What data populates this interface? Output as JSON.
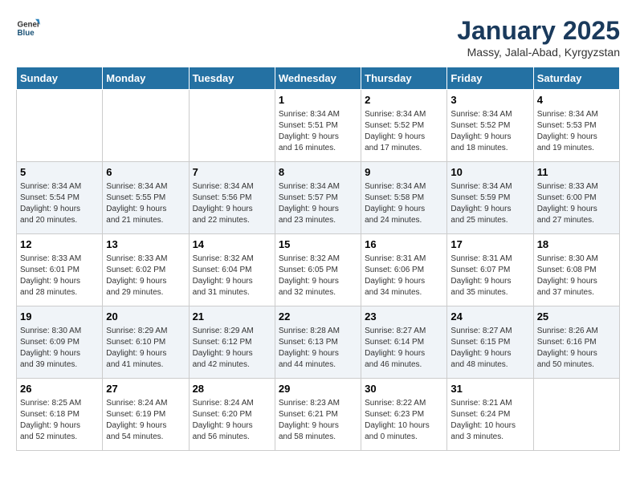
{
  "header": {
    "logo_general": "General",
    "logo_blue": "Blue",
    "month": "January 2025",
    "location": "Massy, Jalal-Abad, Kyrgyzstan"
  },
  "days_of_week": [
    "Sunday",
    "Monday",
    "Tuesday",
    "Wednesday",
    "Thursday",
    "Friday",
    "Saturday"
  ],
  "weeks": [
    {
      "days": [
        {
          "num": "",
          "info": ""
        },
        {
          "num": "",
          "info": ""
        },
        {
          "num": "",
          "info": ""
        },
        {
          "num": "1",
          "info": "Sunrise: 8:34 AM\nSunset: 5:51 PM\nDaylight: 9 hours\nand 16 minutes."
        },
        {
          "num": "2",
          "info": "Sunrise: 8:34 AM\nSunset: 5:52 PM\nDaylight: 9 hours\nand 17 minutes."
        },
        {
          "num": "3",
          "info": "Sunrise: 8:34 AM\nSunset: 5:52 PM\nDaylight: 9 hours\nand 18 minutes."
        },
        {
          "num": "4",
          "info": "Sunrise: 8:34 AM\nSunset: 5:53 PM\nDaylight: 9 hours\nand 19 minutes."
        }
      ]
    },
    {
      "days": [
        {
          "num": "5",
          "info": "Sunrise: 8:34 AM\nSunset: 5:54 PM\nDaylight: 9 hours\nand 20 minutes."
        },
        {
          "num": "6",
          "info": "Sunrise: 8:34 AM\nSunset: 5:55 PM\nDaylight: 9 hours\nand 21 minutes."
        },
        {
          "num": "7",
          "info": "Sunrise: 8:34 AM\nSunset: 5:56 PM\nDaylight: 9 hours\nand 22 minutes."
        },
        {
          "num": "8",
          "info": "Sunrise: 8:34 AM\nSunset: 5:57 PM\nDaylight: 9 hours\nand 23 minutes."
        },
        {
          "num": "9",
          "info": "Sunrise: 8:34 AM\nSunset: 5:58 PM\nDaylight: 9 hours\nand 24 minutes."
        },
        {
          "num": "10",
          "info": "Sunrise: 8:34 AM\nSunset: 5:59 PM\nDaylight: 9 hours\nand 25 minutes."
        },
        {
          "num": "11",
          "info": "Sunrise: 8:33 AM\nSunset: 6:00 PM\nDaylight: 9 hours\nand 27 minutes."
        }
      ]
    },
    {
      "days": [
        {
          "num": "12",
          "info": "Sunrise: 8:33 AM\nSunset: 6:01 PM\nDaylight: 9 hours\nand 28 minutes."
        },
        {
          "num": "13",
          "info": "Sunrise: 8:33 AM\nSunset: 6:02 PM\nDaylight: 9 hours\nand 29 minutes."
        },
        {
          "num": "14",
          "info": "Sunrise: 8:32 AM\nSunset: 6:04 PM\nDaylight: 9 hours\nand 31 minutes."
        },
        {
          "num": "15",
          "info": "Sunrise: 8:32 AM\nSunset: 6:05 PM\nDaylight: 9 hours\nand 32 minutes."
        },
        {
          "num": "16",
          "info": "Sunrise: 8:31 AM\nSunset: 6:06 PM\nDaylight: 9 hours\nand 34 minutes."
        },
        {
          "num": "17",
          "info": "Sunrise: 8:31 AM\nSunset: 6:07 PM\nDaylight: 9 hours\nand 35 minutes."
        },
        {
          "num": "18",
          "info": "Sunrise: 8:30 AM\nSunset: 6:08 PM\nDaylight: 9 hours\nand 37 minutes."
        }
      ]
    },
    {
      "days": [
        {
          "num": "19",
          "info": "Sunrise: 8:30 AM\nSunset: 6:09 PM\nDaylight: 9 hours\nand 39 minutes."
        },
        {
          "num": "20",
          "info": "Sunrise: 8:29 AM\nSunset: 6:10 PM\nDaylight: 9 hours\nand 41 minutes."
        },
        {
          "num": "21",
          "info": "Sunrise: 8:29 AM\nSunset: 6:12 PM\nDaylight: 9 hours\nand 42 minutes."
        },
        {
          "num": "22",
          "info": "Sunrise: 8:28 AM\nSunset: 6:13 PM\nDaylight: 9 hours\nand 44 minutes."
        },
        {
          "num": "23",
          "info": "Sunrise: 8:27 AM\nSunset: 6:14 PM\nDaylight: 9 hours\nand 46 minutes."
        },
        {
          "num": "24",
          "info": "Sunrise: 8:27 AM\nSunset: 6:15 PM\nDaylight: 9 hours\nand 48 minutes."
        },
        {
          "num": "25",
          "info": "Sunrise: 8:26 AM\nSunset: 6:16 PM\nDaylight: 9 hours\nand 50 minutes."
        }
      ]
    },
    {
      "days": [
        {
          "num": "26",
          "info": "Sunrise: 8:25 AM\nSunset: 6:18 PM\nDaylight: 9 hours\nand 52 minutes."
        },
        {
          "num": "27",
          "info": "Sunrise: 8:24 AM\nSunset: 6:19 PM\nDaylight: 9 hours\nand 54 minutes."
        },
        {
          "num": "28",
          "info": "Sunrise: 8:24 AM\nSunset: 6:20 PM\nDaylight: 9 hours\nand 56 minutes."
        },
        {
          "num": "29",
          "info": "Sunrise: 8:23 AM\nSunset: 6:21 PM\nDaylight: 9 hours\nand 58 minutes."
        },
        {
          "num": "30",
          "info": "Sunrise: 8:22 AM\nSunset: 6:23 PM\nDaylight: 10 hours\nand 0 minutes."
        },
        {
          "num": "31",
          "info": "Sunrise: 8:21 AM\nSunset: 6:24 PM\nDaylight: 10 hours\nand 3 minutes."
        },
        {
          "num": "",
          "info": ""
        }
      ]
    }
  ]
}
